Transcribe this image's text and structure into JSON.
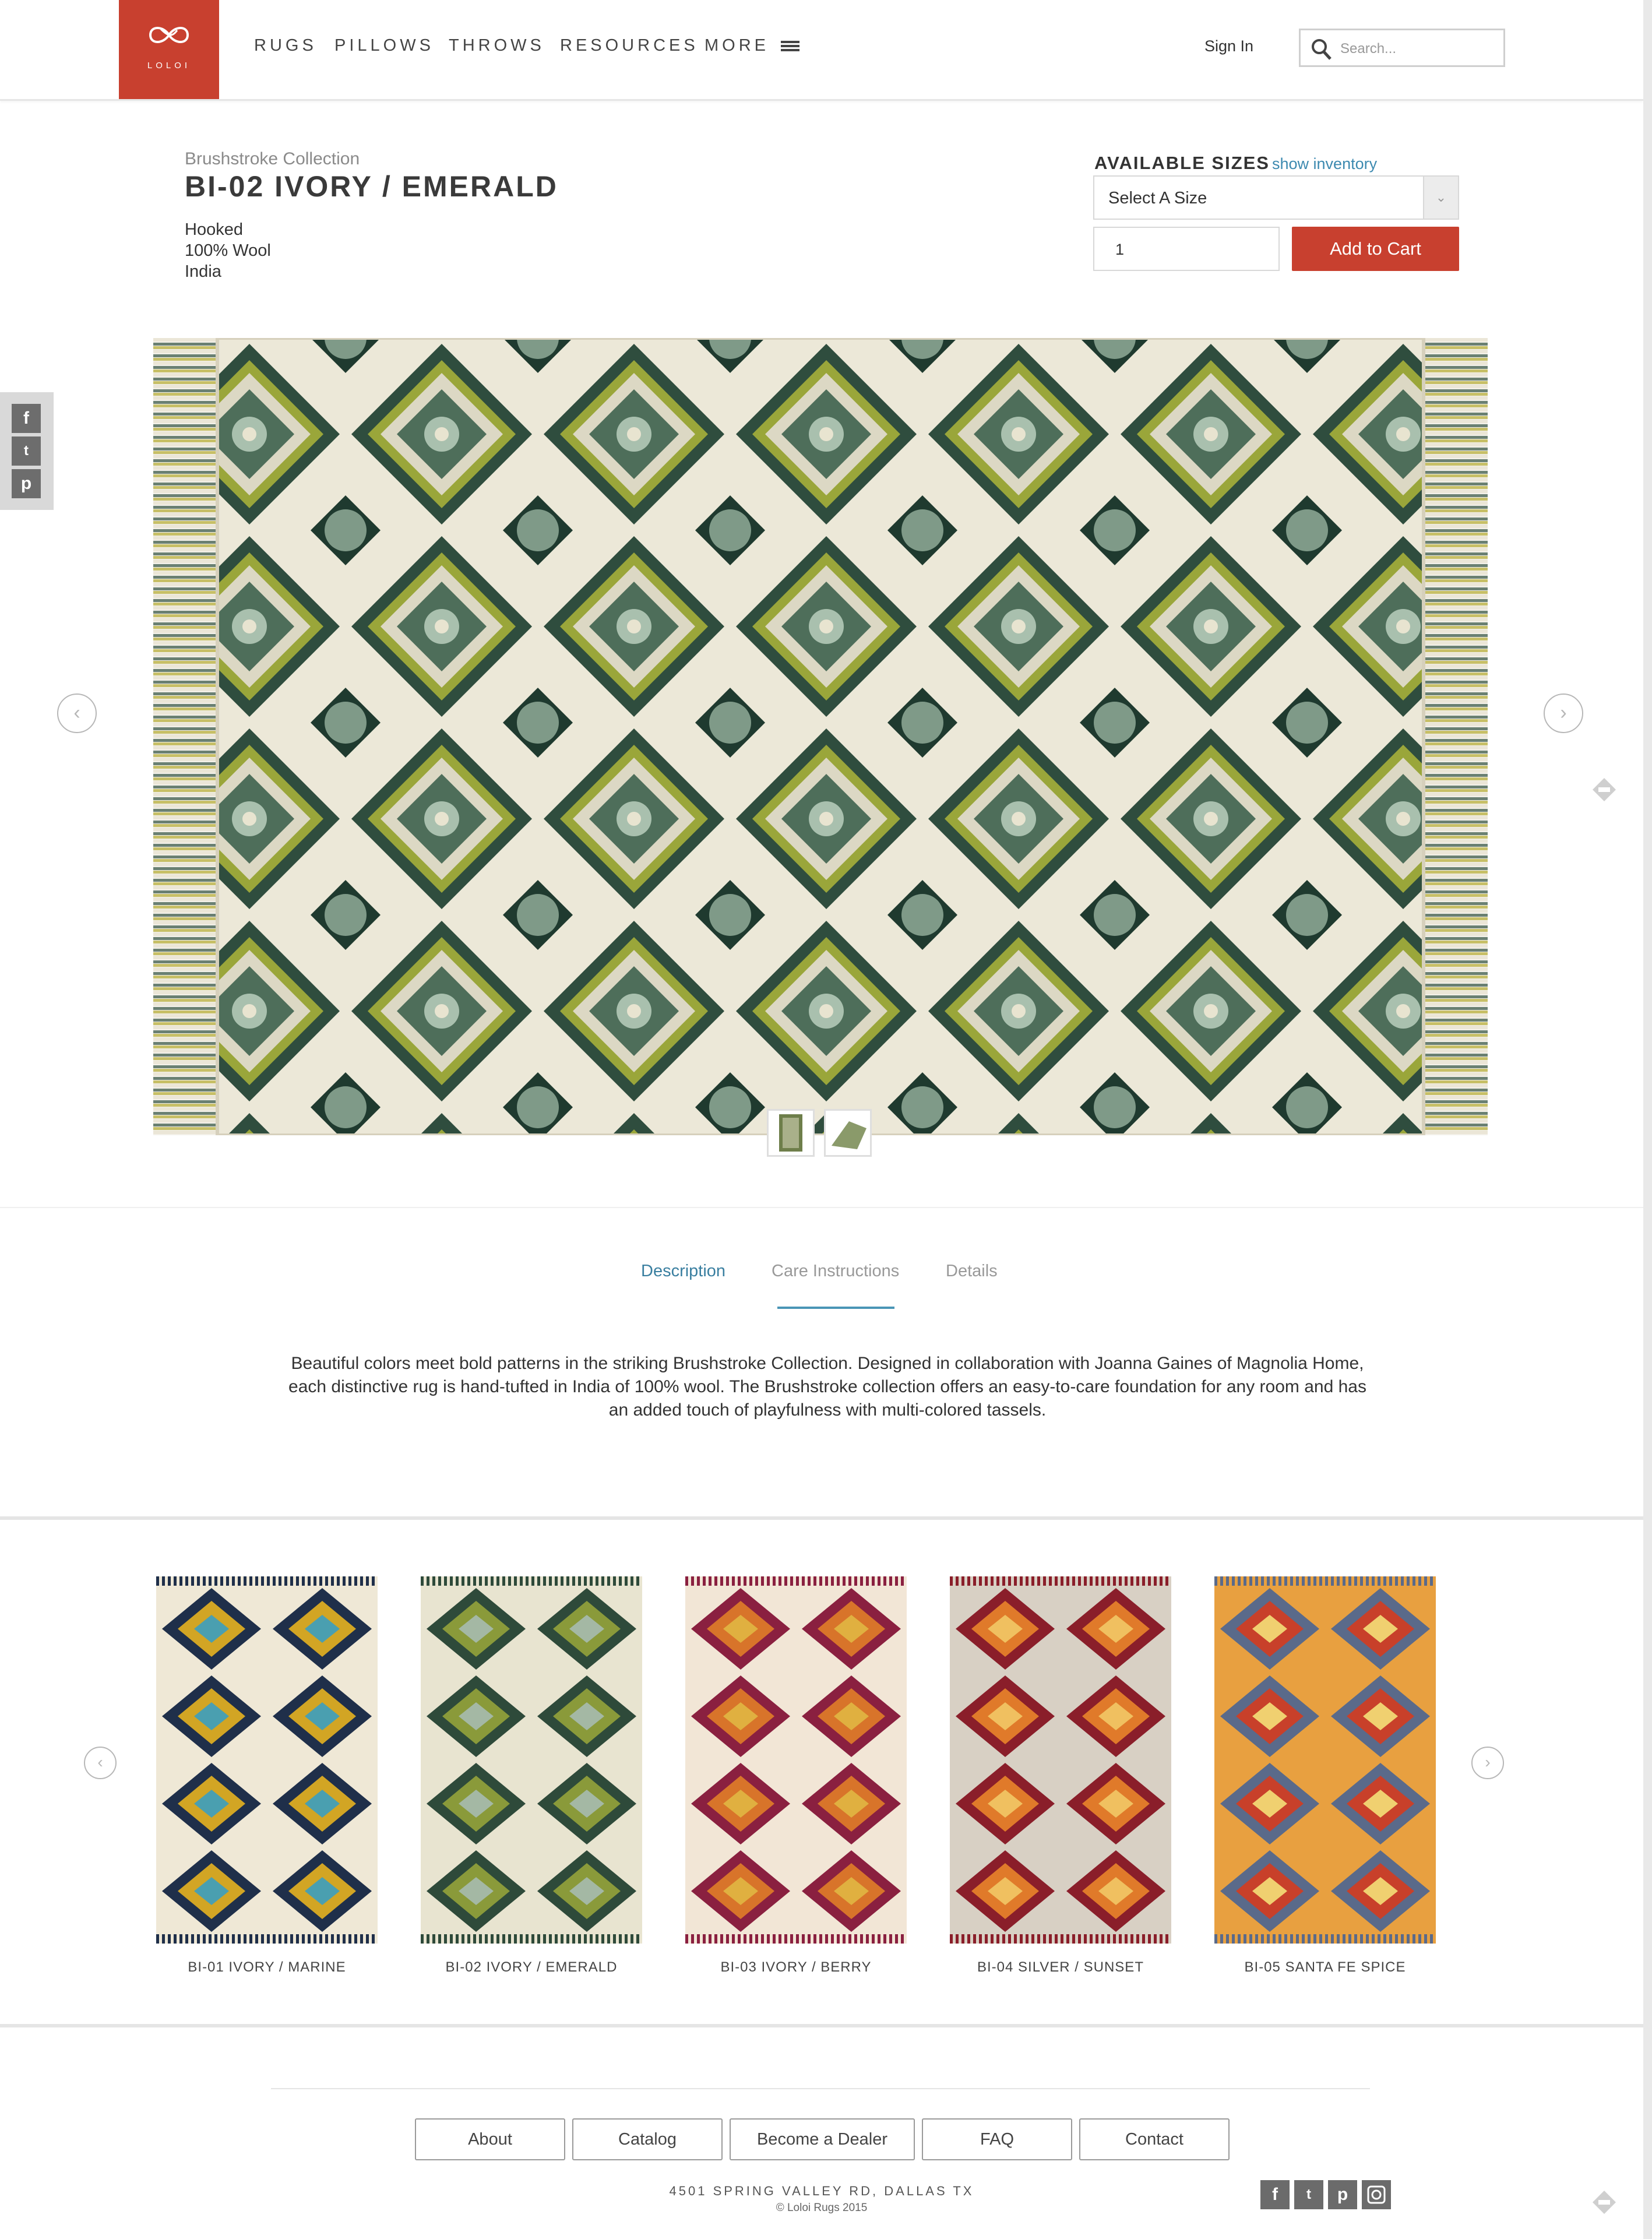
{
  "header": {
    "logo_text": "LOLOI",
    "nav": [
      "RUGS",
      "PILLOWS",
      "THROWS",
      "RESOURCES",
      "MORE"
    ],
    "sign_in": "Sign In",
    "search_placeholder": "Search..."
  },
  "product": {
    "collection": "Brushstroke Collection",
    "title": "BI-02 IVORY / EMERALD",
    "specs": [
      "Hooked",
      "100% Wool",
      "India"
    ],
    "available_sizes_label": "AVAILABLE SIZES",
    "show_inventory": "show inventory",
    "size_select": "Select A Size",
    "quantity": "1",
    "add_to_cart": "Add to Cart"
  },
  "tabs": [
    {
      "label": "Description",
      "active": true
    },
    {
      "label": "Care Instructions",
      "active": false
    },
    {
      "label": "Details",
      "active": false
    }
  ],
  "description": "Beautiful colors meet bold patterns in the striking Brushstroke Collection. Designed in collaboration with Joanna Gaines of Magnolia Home, each distinctive rug is hand-tufted in India of 100% wool.  The Brushstroke collection offers an easy-to-care foundation for any room and has an added touch of playfulness with multi-colored tassels.",
  "related": [
    {
      "caption": "BI-01 IVORY / MARINE",
      "palette": [
        "#efe8d6",
        "#1f2f4a",
        "#d2a524",
        "#4a9fb0"
      ]
    },
    {
      "caption": "BI-02 IVORY / EMERALD",
      "palette": [
        "#e8e4d0",
        "#2e4a3a",
        "#8a9a3a",
        "#a4b8a4"
      ]
    },
    {
      "caption": "BI-03 IVORY / BERRY",
      "palette": [
        "#f2e6d6",
        "#8a2040",
        "#d8742a",
        "#e0b040"
      ]
    },
    {
      "caption": "BI-04 SILVER / SUNSET",
      "palette": [
        "#d8d0c4",
        "#8a1e2a",
        "#e07a2a",
        "#f0c060"
      ]
    },
    {
      "caption": "BI-05 SANTA FE SPICE",
      "palette": [
        "#e8a040",
        "#5a6a8a",
        "#c8402a",
        "#f0d070"
      ]
    }
  ],
  "footer": {
    "buttons": [
      "About",
      "Catalog",
      "Become a Dealer",
      "FAQ",
      "Contact"
    ],
    "address": "4501 SPRING VALLEY RD, DALLAS TX",
    "copyright": "© Loloi Rugs 2015"
  },
  "icons": {
    "social": [
      "facebook-icon",
      "twitter-icon",
      "pinterest-icon",
      "instagram-icon"
    ]
  },
  "colors": {
    "brand": "#c8402f",
    "link": "#3d8ab0"
  }
}
